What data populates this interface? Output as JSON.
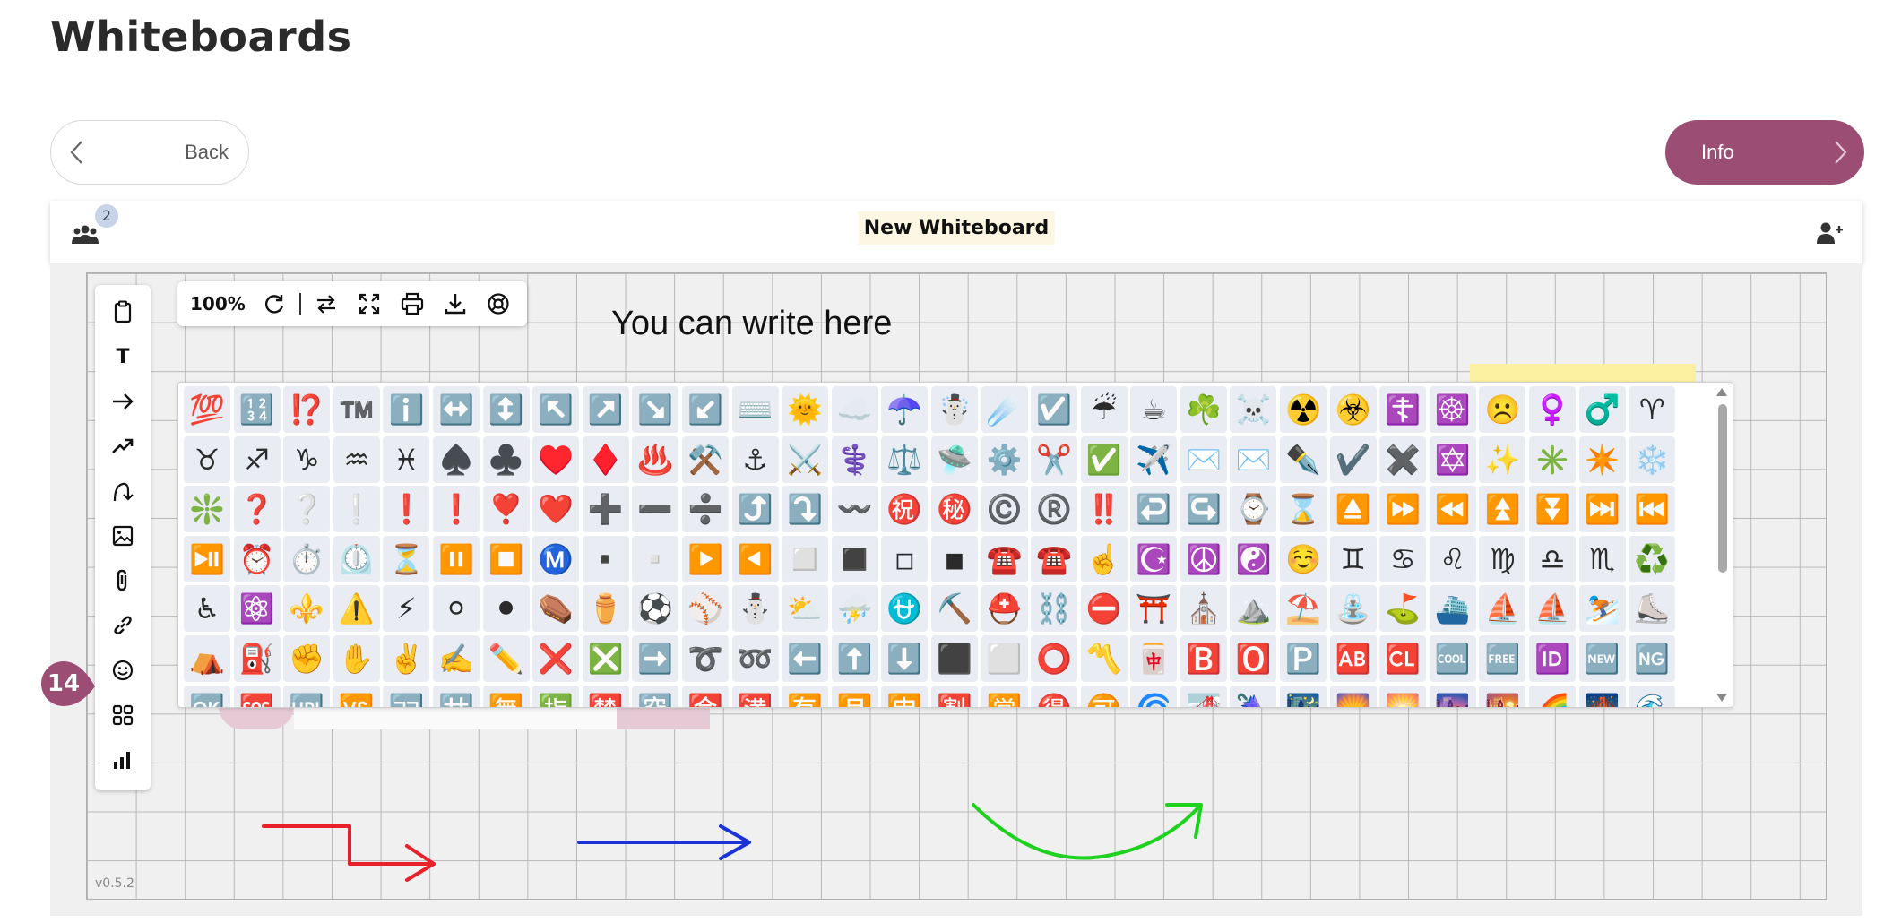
{
  "page": {
    "title": "Whiteboards"
  },
  "nav": {
    "back_label": "Back",
    "info_label": "Info"
  },
  "whiteboard": {
    "title": "New Whiteboard",
    "users_count": "2",
    "version": "v0.5.2"
  },
  "toolbar": {
    "zoom": "100%"
  },
  "board": {
    "text": "You can write here"
  },
  "step_badge": "14",
  "emojis": [
    "💯",
    "🔢",
    "⁉️",
    "™️",
    "ℹ️",
    "↔️",
    "↕️",
    "↖️",
    "↗️",
    "↘️",
    "↙️",
    "⌨️",
    "🌞",
    "☁️",
    "☂️",
    "☃️",
    "☄️",
    "☑️",
    "☔",
    "☕",
    "☘️",
    "☠️",
    "☢️",
    "☣️",
    "☦️",
    "☸️",
    "☹️",
    "♀️",
    "♂️",
    "♈",
    "♉",
    "♐",
    "♑",
    "♒",
    "♓",
    "♠️",
    "♣️",
    "♥️",
    "♦️",
    "♨️",
    "⚒️",
    "⚓",
    "⚔️",
    "⚕️",
    "⚖️",
    "🛸",
    "⚙️",
    "✂️",
    "✅",
    "✈️",
    "✉️",
    "✉️",
    "✒️",
    "✔️",
    "✖️",
    "✡️",
    "✨",
    "✳️",
    "✴️",
    "❄️",
    "❇️",
    "❓",
    "❔",
    "❕",
    "❗",
    "❗",
    "❣️",
    "❤️",
    "➕",
    "➖",
    "➗",
    "⤴️",
    "⤵️",
    "〰️",
    "㊗️",
    "㊙️",
    "©️",
    "®️",
    "‼️",
    "↩️",
    "↪️",
    "⌚",
    "⌛",
    "⏏️",
    "⏩",
    "⏪",
    "⏫",
    "⏬",
    "⏭️",
    "⏮️",
    "⏯️",
    "⏰",
    "⏱️",
    "⏲️",
    "⏳",
    "⏸️",
    "⏹️",
    "Ⓜ️",
    "▪️",
    "▫️",
    "▶️",
    "◀️",
    "◻️",
    "◼️",
    "◽",
    "◾",
    "☎️",
    "☎️",
    "☝️",
    "☪️",
    "☮️",
    "☯️",
    "☺️",
    "♊",
    "♋",
    "♌",
    "♍",
    "♎",
    "♏",
    "♻️",
    "♿",
    "⚛️",
    "⚜️",
    "⚠️",
    "⚡",
    "⚪",
    "⚫",
    "⚰️",
    "⚱️",
    "⚽",
    "⚾",
    "⛄",
    "⛅",
    "⛈️",
    "⛎",
    "⛏️",
    "⛑️",
    "⛓️",
    "⛔",
    "⛩️",
    "⛪",
    "⛰️",
    "⛱️",
    "⛲",
    "⛳",
    "⛴️",
    "⛵",
    "⛵",
    "⛷️",
    "⛸️",
    "⛺",
    "⛽",
    "✊",
    "✋",
    "✌️",
    "✍️",
    "✏️",
    "❌",
    "❎",
    "➡️",
    "➰",
    "➿",
    "⬅️",
    "⬆️",
    "⬇️",
    "⬛",
    "⬜",
    "⭕",
    "〽️",
    "🀄",
    "🅱️",
    "🅾️",
    "🅿️",
    "🆎",
    "🆑",
    "🆒",
    "🆓",
    "🆔",
    "🆕",
    "🆖",
    "🆗",
    "🆘",
    "🆙",
    "🆚",
    "🈁",
    "🈂️",
    "🈚",
    "🈯",
    "🈲",
    "🈳",
    "🈴",
    "🈵",
    "🈶",
    "🈷️",
    "🈸",
    "🈹",
    "🈺",
    "🉐",
    "🉑",
    "🌀",
    "🌁",
    "🌂",
    "🌃",
    "🌄",
    "🌅",
    "🌆",
    "🌇",
    "🌈",
    "🌉",
    "🌊"
  ]
}
